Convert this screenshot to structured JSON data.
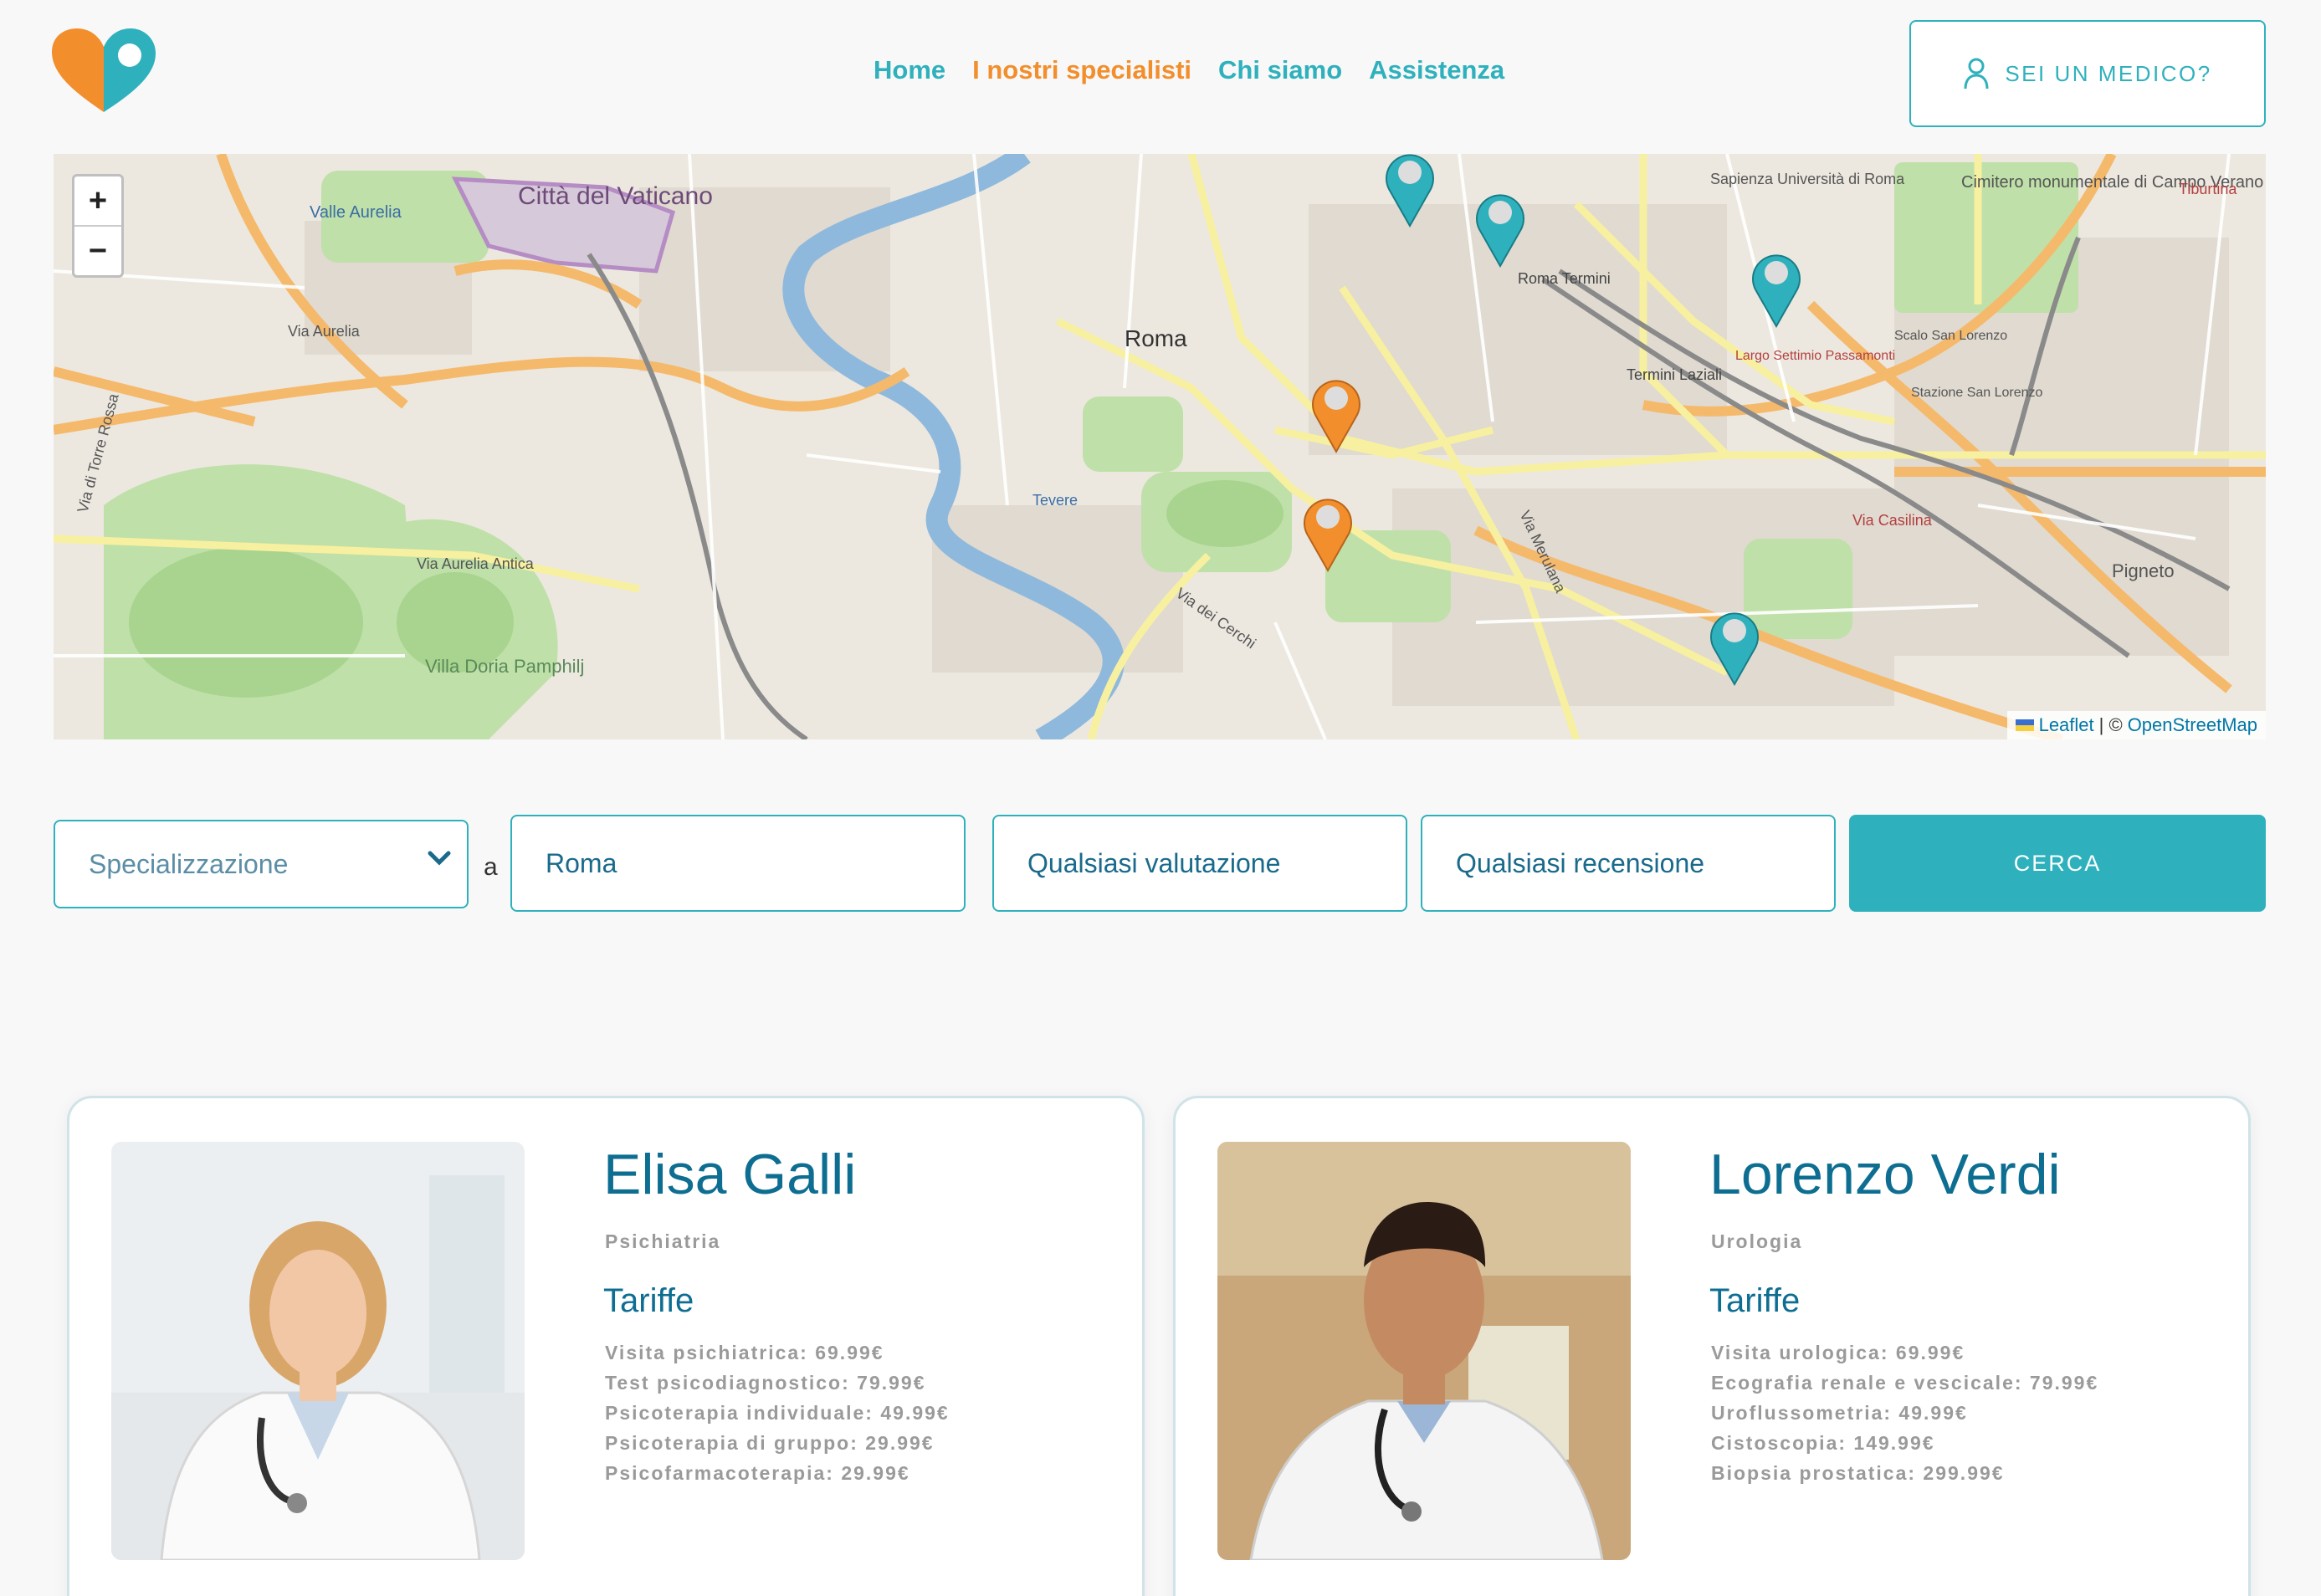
{
  "header": {
    "nav": [
      "Home",
      "I nostri specialisti",
      "Chi siamo",
      "Assistenza"
    ],
    "active_nav": "I nostri specialisti",
    "doctor_button": "SEI UN MEDICO?",
    "brand_colors": {
      "orange": "#f28e2c",
      "teal": "#2fb1bd"
    }
  },
  "map": {
    "zoom_in": "+",
    "zoom_out": "−",
    "attribution_leaflet": "Leaflet",
    "attribution_sep": "| ©",
    "attribution_osm": "OpenStreetMap",
    "labels": [
      "Città del Vaticano",
      "Roma",
      "Roma Termini",
      "Termini Laziali",
      "Valle Aurelia",
      "Via Aurelia",
      "Via Aurelia Antica",
      "Villa Doria Pamphilj",
      "Via Merulana",
      "Via dei Cerchi",
      "Via Casilina",
      "Pigneto",
      "Tevere",
      "Sapienza Università di Roma",
      "Cimitero monumentale di Campo Verano",
      "Tiburtina",
      "Scalo San Lorenzo",
      "Largo Settimio Passamonti",
      "Stazione San Lorenzo",
      "Via di Torre Rossa"
    ]
  },
  "search": {
    "specialization_placeholder": "Specializzazione",
    "a_label": "a",
    "city": "Roma",
    "rating": "Qualsiasi valutazione",
    "reviews": "Qualsiasi recensione",
    "submit": "CERCA"
  },
  "doctors": [
    {
      "name": "Elisa Galli",
      "specialty": "Psichiatria",
      "tariffe_label": "Tariffe",
      "prices": [
        "Visita psichiatrica: 69.99€",
        "Test psicodiagnostico: 79.99€",
        "Psicoterapia individuale: 49.99€",
        "Psicoterapia di gruppo: 29.99€",
        "Psicofarmacoterapia: 29.99€"
      ]
    },
    {
      "name": "Lorenzo Verdi",
      "specialty": "Urologia",
      "tariffe_label": "Tariffe",
      "prices": [
        "Visita urologica: 69.99€",
        "Ecografia renale e vescicale: 79.99€",
        "Uroflussometria: 49.99€",
        "Cistoscopia: 149.99€",
        "Biopsia prostatica: 299.99€"
      ]
    }
  ]
}
